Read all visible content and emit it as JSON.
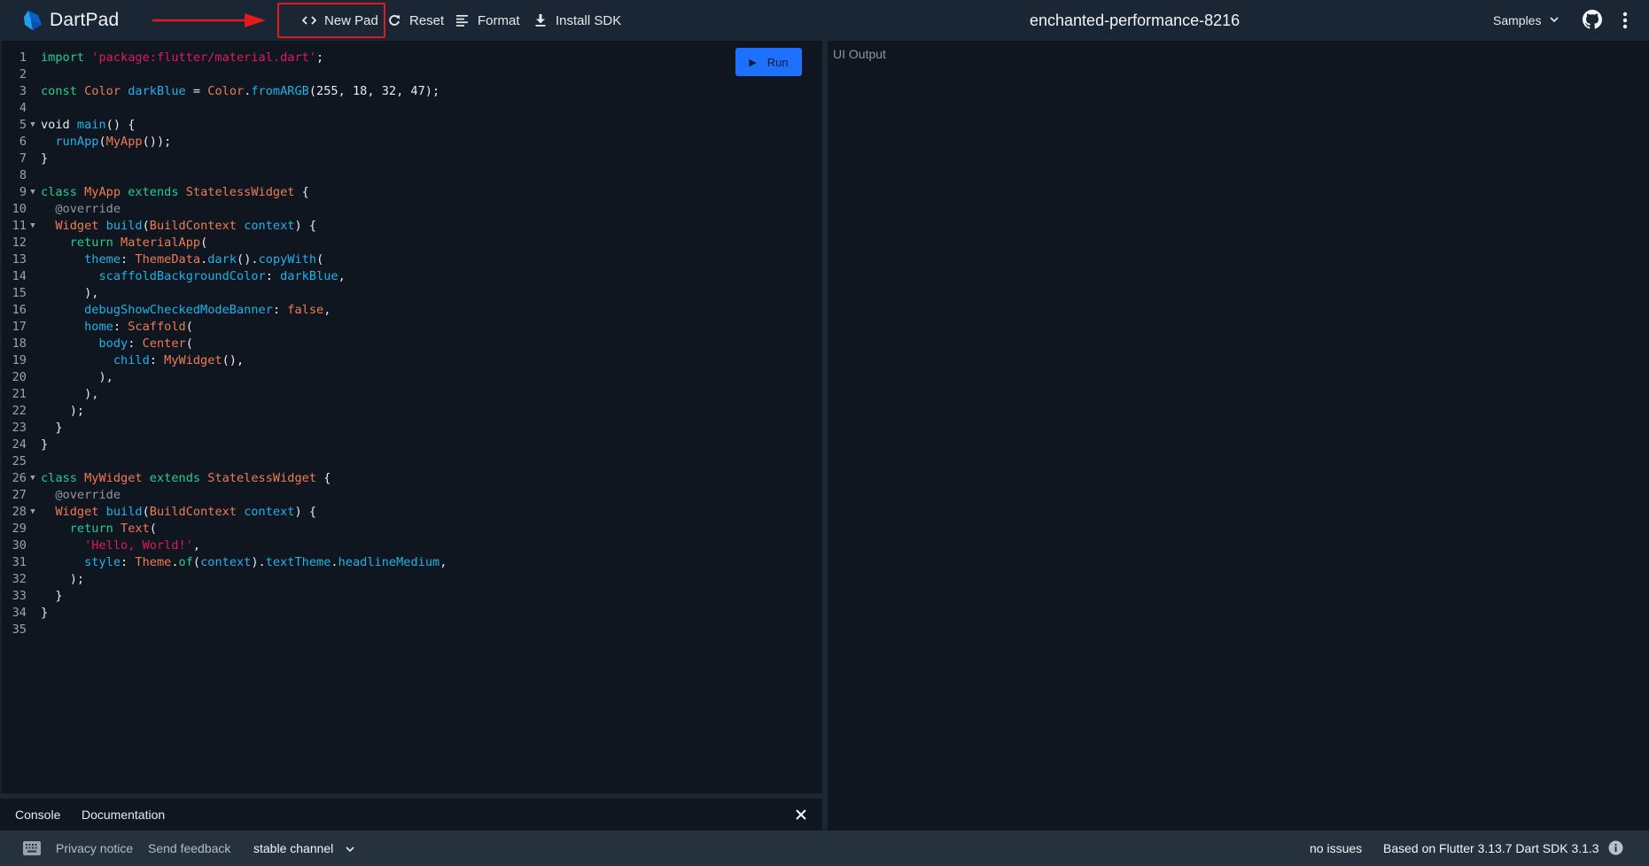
{
  "app": {
    "name": "DartPad",
    "pad_title": "enchanted-performance-8216"
  },
  "toolbar": {
    "new_pad": "New Pad",
    "reset": "Reset",
    "format": "Format",
    "install_sdk": "Install SDK",
    "samples": "Samples"
  },
  "annotation": {
    "highlight_color": "#e01b1b",
    "target": "New Pad"
  },
  "editor": {
    "run_label": "Run",
    "run_color": "#1e70ff",
    "lines": [
      {
        "n": "1",
        "fold": false,
        "html": "<span class='k'>import</span> <span class='s'>'package:flutter/material.dart'</span>;"
      },
      {
        "n": "2",
        "fold": false,
        "html": ""
      },
      {
        "n": "3",
        "fold": false,
        "html": "<span class='k'>const</span> <span class='t'>Color</span> <span class='f'>darkBlue</span> = <span class='t'>Color</span>.<span class='f'>fromARGB</span>(255, 18, 32, 47);"
      },
      {
        "n": "4",
        "fold": false,
        "html": ""
      },
      {
        "n": "5",
        "fold": true,
        "html": "void <span class='f'>main</span>() {"
      },
      {
        "n": "6",
        "fold": false,
        "html": "  <span class='f'>runApp</span>(<span class='t'>MyApp</span>());"
      },
      {
        "n": "7",
        "fold": false,
        "html": "}"
      },
      {
        "n": "8",
        "fold": false,
        "html": ""
      },
      {
        "n": "9",
        "fold": true,
        "html": "<span class='k'>class</span> <span class='t'>MyApp</span> <span class='k'>extends</span> <span class='t'>StatelessWidget</span> {"
      },
      {
        "n": "10",
        "fold": false,
        "html": "  <span class='a'>@override</span>"
      },
      {
        "n": "11",
        "fold": true,
        "html": "  <span class='t'>Widget</span> <span class='f'>build</span>(<span class='t'>BuildContext</span> <span class='f'>context</span>) {"
      },
      {
        "n": "12",
        "fold": false,
        "html": "    <span class='k'>return</span> <span class='t'>MaterialApp</span>("
      },
      {
        "n": "13",
        "fold": false,
        "html": "      <span class='f'>theme</span>: <span class='t'>ThemeData</span>.<span class='f'>dark</span>().<span class='f'>copyWith</span>("
      },
      {
        "n": "14",
        "fold": false,
        "html": "        <span class='f'>scaffoldBackgroundColor</span>: <span class='f'>darkBlue</span>,"
      },
      {
        "n": "15",
        "fold": false,
        "html": "      ),"
      },
      {
        "n": "16",
        "fold": false,
        "html": "      <span class='f'>debugShowCheckedModeBanner</span>: <span class='t'>false</span>,"
      },
      {
        "n": "17",
        "fold": false,
        "html": "      <span class='f'>home</span>: <span class='t'>Scaffold</span>("
      },
      {
        "n": "18",
        "fold": false,
        "html": "        <span class='f'>body</span>: <span class='t'>Center</span>("
      },
      {
        "n": "19",
        "fold": false,
        "html": "          <span class='f'>child</span>: <span class='t'>MyWidget</span>(),"
      },
      {
        "n": "20",
        "fold": false,
        "html": "        ),"
      },
      {
        "n": "21",
        "fold": false,
        "html": "      ),"
      },
      {
        "n": "22",
        "fold": false,
        "html": "    );"
      },
      {
        "n": "23",
        "fold": false,
        "html": "  }"
      },
      {
        "n": "24",
        "fold": false,
        "html": "}"
      },
      {
        "n": "25",
        "fold": false,
        "html": ""
      },
      {
        "n": "26",
        "fold": true,
        "html": "<span class='k'>class</span> <span class='t'>MyWidget</span> <span class='k'>extends</span> <span class='t'>StatelessWidget</span> {"
      },
      {
        "n": "27",
        "fold": false,
        "html": "  <span class='a'>@override</span>"
      },
      {
        "n": "28",
        "fold": true,
        "html": "  <span class='t'>Widget</span> <span class='f'>build</span>(<span class='t'>BuildContext</span> <span class='f'>context</span>) {"
      },
      {
        "n": "29",
        "fold": false,
        "html": "    <span class='k'>return</span> <span class='t'>Text</span>("
      },
      {
        "n": "30",
        "fold": false,
        "html": "      <span class='s'>'Hello, World!'</span>,"
      },
      {
        "n": "31",
        "fold": false,
        "html": "      <span class='f'>style</span>: <span class='t'>Theme</span>.<span class='k'>of</span>(<span class='f'>context</span>).<span class='f'>textTheme</span>.<span class='f'>headlineMedium</span>,"
      },
      {
        "n": "32",
        "fold": false,
        "html": "    );"
      },
      {
        "n": "33",
        "fold": false,
        "html": "  }"
      },
      {
        "n": "34",
        "fold": false,
        "html": "}"
      },
      {
        "n": "35",
        "fold": false,
        "html": ""
      }
    ]
  },
  "output": {
    "label": "UI Output"
  },
  "console": {
    "tabs": [
      "Console",
      "Documentation"
    ]
  },
  "status": {
    "privacy": "Privacy notice",
    "feedback": "Send feedback",
    "channel": "stable channel",
    "issues": "no issues",
    "version": "Based on Flutter 3.13.7 Dart SDK 3.1.3"
  }
}
